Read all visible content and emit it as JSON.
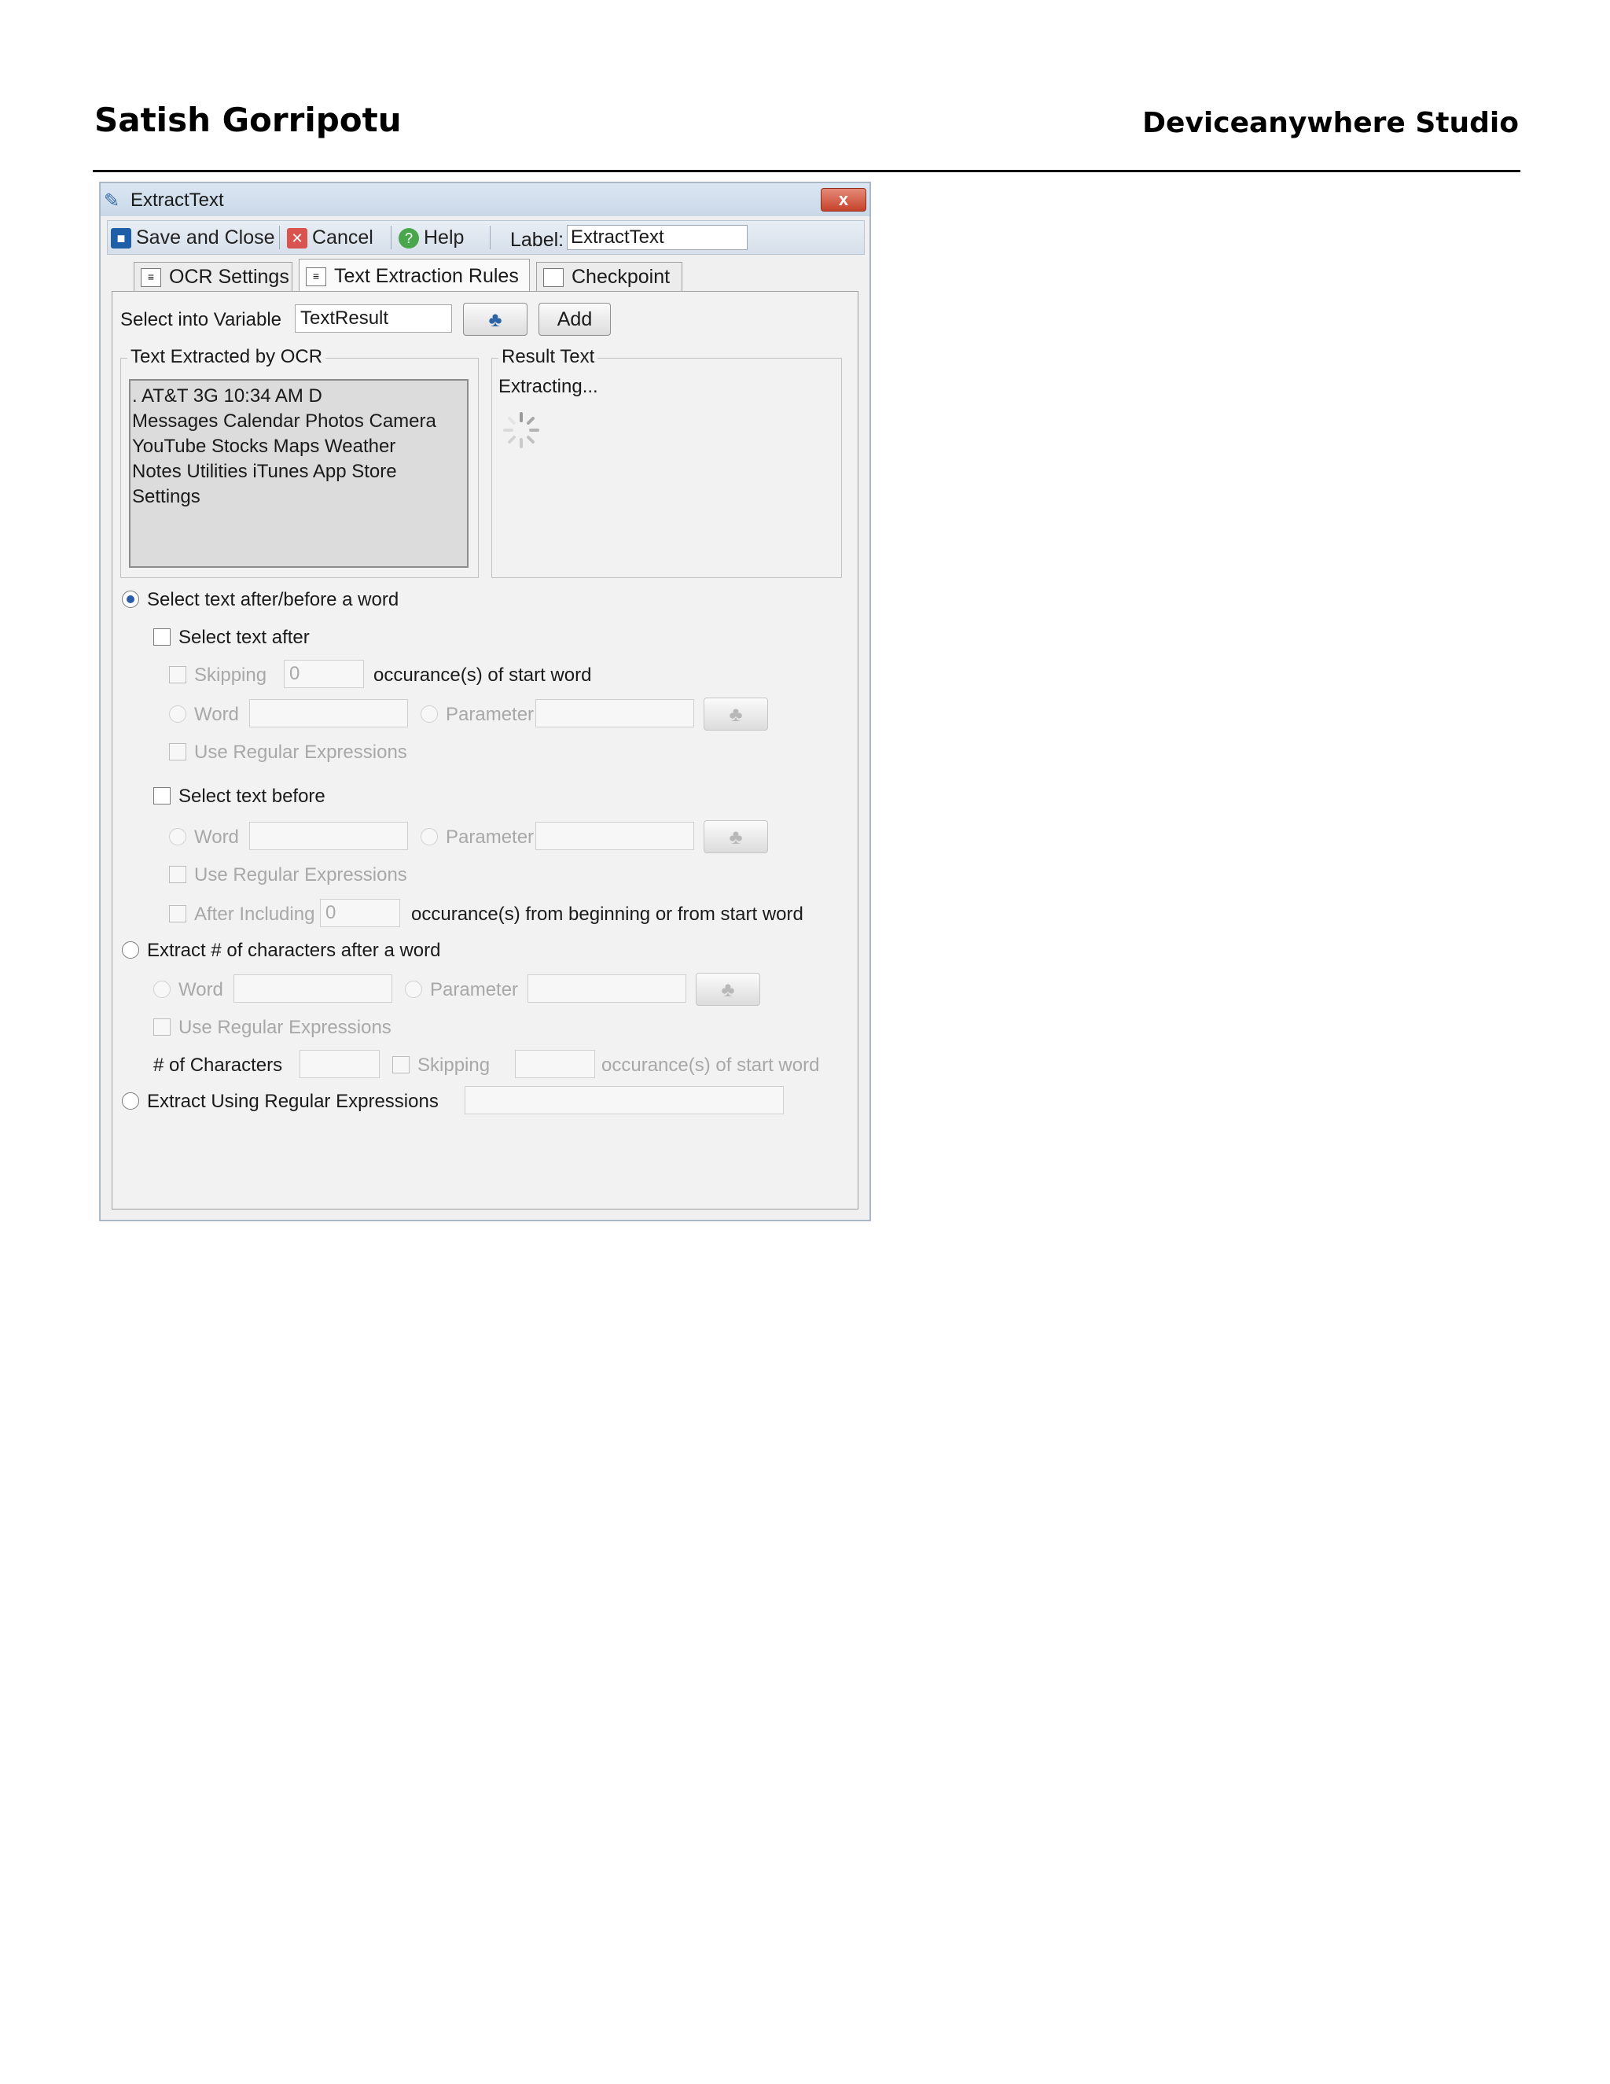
{
  "page_header": {
    "author": "Satish Gorripotu",
    "app_name": "Deviceanywhere Studio"
  },
  "dialog": {
    "title": "ExtractText",
    "close_glyph": "x",
    "toolbar": {
      "save_close": "Save and Close",
      "cancel": "Cancel",
      "help": "Help",
      "label_caption": "Label:",
      "label_value": "ExtractText"
    },
    "tabs": [
      {
        "label": "OCR Settings",
        "active": false
      },
      {
        "label": "Text Extraction Rules",
        "active": true
      },
      {
        "label": "Checkpoint",
        "active": false
      }
    ],
    "select_variable": {
      "label": "Select into Variable",
      "value": "TextResult",
      "add_button": "Add"
    },
    "ocr_group": {
      "legend": "Text Extracted by OCR",
      "lines": [
        ". AT&T 3G 10:34 AM D",
        "Messages Calendar Photos Camera",
        "YouTube Stocks Maps Weather",
        "Notes Utilities iTunes App Store",
        "Settings"
      ]
    },
    "result_group": {
      "legend": "Result Text",
      "status": "Extracting..."
    },
    "opt_after_before": {
      "label": "Select text after/before a word",
      "selected": true,
      "select_after": {
        "label": "Select text after",
        "skipping_label": "Skipping",
        "skipping_value": "0",
        "skipping_suffix": "occurance(s) of start word",
        "word_label": "Word",
        "parameter_label": "Parameter",
        "regex_label": "Use Regular Expressions"
      },
      "select_before": {
        "label": "Select text before",
        "word_label": "Word",
        "parameter_label": "Parameter",
        "regex_label": "Use Regular Expressions",
        "after_including_label": "After Including",
        "after_including_value": "0",
        "after_including_suffix": "occurance(s) from beginning or from start word"
      }
    },
    "opt_num_chars": {
      "label": "Extract # of characters after a word",
      "selected": false,
      "word_label": "Word",
      "parameter_label": "Parameter",
      "regex_label": "Use Regular Expressions",
      "num_chars_label": "# of Characters",
      "skipping_label": "Skipping",
      "skipping_suffix": "occurance(s) of start word"
    },
    "opt_regex": {
      "label": "Extract Using Regular Expressions",
      "selected": false
    },
    "icons": {
      "title": "extract-text-icon",
      "save": "floppy-disk-icon",
      "cancel": "cancel-icon",
      "help": "help-icon",
      "parameter": "puzzle-piece-icon",
      "tab": "document-icon",
      "loading": "spinner-icon",
      "pointer": "mouse-cursor-icon"
    },
    "colors": {
      "titlebar": "#c9d8e8",
      "close_button": "#c7422b",
      "accent": "#2b63a6",
      "disabled_text": "#a8a8a8"
    }
  }
}
